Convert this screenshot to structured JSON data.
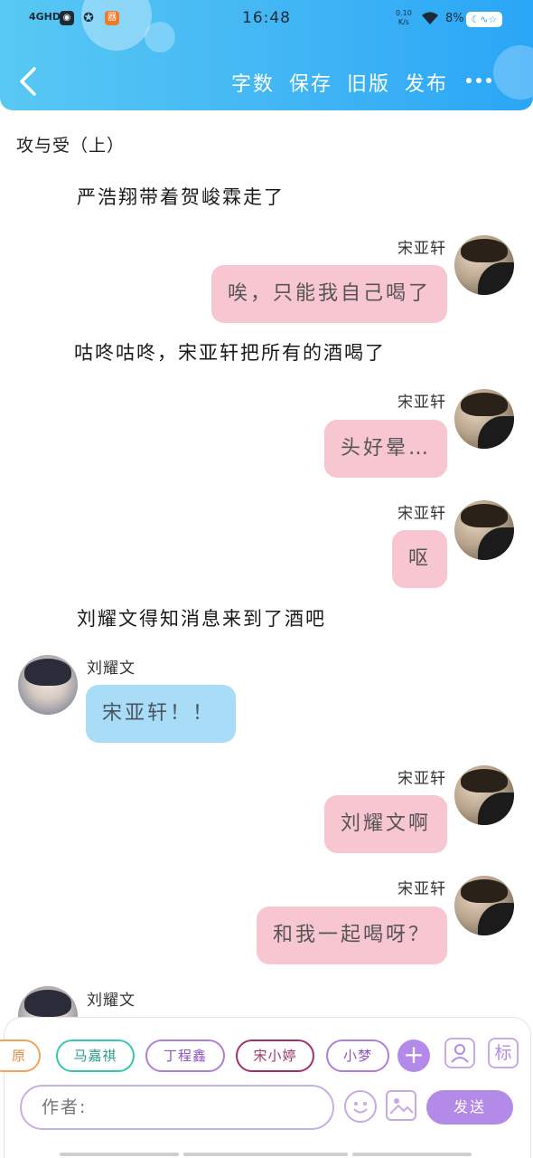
{
  "status_bar": {
    "signal": "4GHD",
    "time": "16:48",
    "speed_value": "0.10",
    "speed_unit": "K/s",
    "battery": "8%"
  },
  "nav": {
    "actions": [
      "字数",
      "保存",
      "旧版",
      "发布"
    ]
  },
  "chapter_title": "攻与受（上）",
  "messages": [
    {
      "type": "narration",
      "text": "严浩翔带着贺峻霖走了"
    },
    {
      "type": "right",
      "speaker": "宋亚轩",
      "text": "唉，只能我自己喝了"
    },
    {
      "type": "narration",
      "text": "咕咚咕咚，宋亚轩把所有的酒喝了"
    },
    {
      "type": "right",
      "speaker": "宋亚轩",
      "text": "头好晕…"
    },
    {
      "type": "right",
      "speaker": "宋亚轩",
      "text": "呕"
    },
    {
      "type": "narration",
      "text": "刘耀文得知消息来到了酒吧"
    },
    {
      "type": "left",
      "speaker": "刘耀文",
      "text": "宋亚轩！！"
    },
    {
      "type": "right",
      "speaker": "宋亚轩",
      "text": "刘耀文啊"
    },
    {
      "type": "right",
      "speaker": "宋亚轩",
      "text": "和我一起喝呀？"
    },
    {
      "type": "left",
      "speaker": "刘耀文",
      "text": ""
    }
  ],
  "bottom_bar": {
    "characters": [
      "原",
      "马嘉祺",
      "丁程鑫",
      "宋小婷",
      "小梦"
    ],
    "tag_label": "标",
    "input_placeholder": "作者:",
    "send_label": "发送"
  },
  "colors": {
    "header": "#3fb4f5",
    "bubble_right": "#f8c6d0",
    "bubble_left": "#a8dcf7",
    "accent": "#b48ae8"
  }
}
